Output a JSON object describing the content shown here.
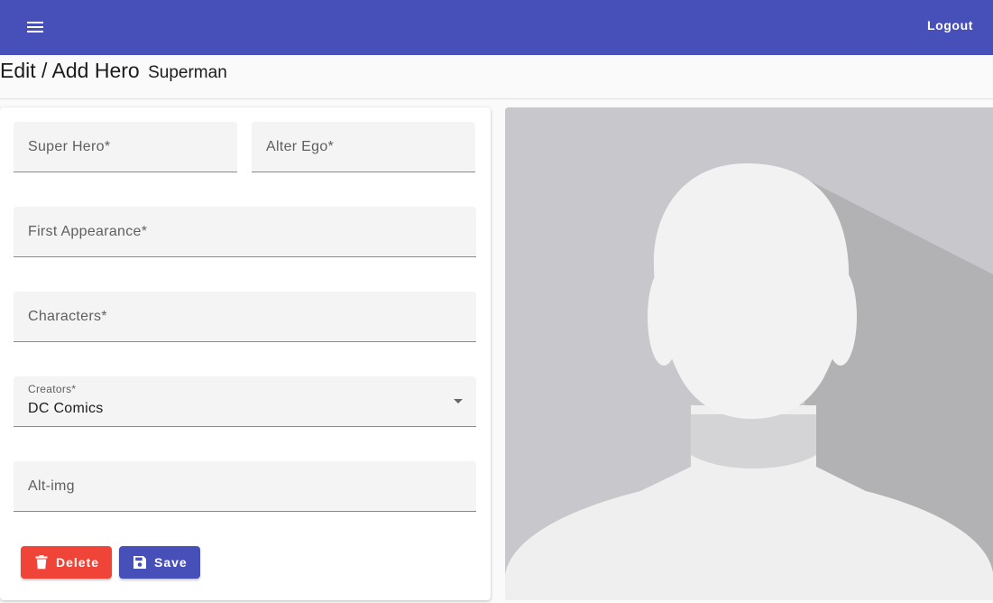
{
  "toolbar": {
    "menu_icon": "menu-icon",
    "logout_label": "Logout",
    "bg_color": "#4750b9"
  },
  "page": {
    "title": "Edit / Add Hero",
    "subtitle": "Superman"
  },
  "form": {
    "super_hero_label": "Super Hero*",
    "alter_ego_label": "Alter Ego*",
    "first_appearance_label": "First Appearance*",
    "characters_label": "Characters*",
    "creators": {
      "label": "Creators*",
      "value": "DC Comics"
    },
    "alt_img_label": "Alt-img"
  },
  "buttons": {
    "delete": {
      "label": "Delete",
      "icon": "trash-icon",
      "color": "#f04438"
    },
    "save": {
      "label": "Save",
      "icon": "floppy-disk-icon",
      "color": "#4750b9"
    }
  },
  "hero_image": {
    "icon": "avatar-placeholder"
  }
}
